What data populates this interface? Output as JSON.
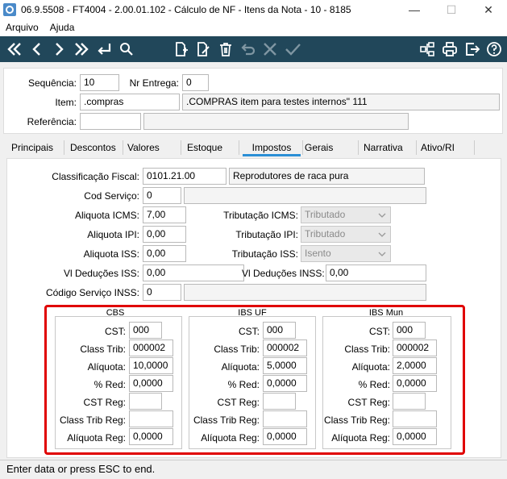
{
  "window": {
    "title": "06.9.5508 - FT4004 - 2.00.01.102 - Cálculo de NF - Itens da Nota - 10 - 8185",
    "minimize": "—",
    "maximize": "☐",
    "close": "✕"
  },
  "menu": {
    "arquivo": "Arquivo",
    "ajuda": "Ajuda"
  },
  "toolbar_icons": [
    "first-icon",
    "prev-icon",
    "next-icon",
    "last-icon",
    "return-icon",
    "search-icon",
    "new-icon",
    "edit-icon",
    "delete-icon",
    "undo-icon",
    "cancel-icon",
    "confirm-icon",
    "tree-icon",
    "print-icon",
    "exit-icon",
    "help-icon"
  ],
  "header": {
    "sequencia_label": "Sequência:",
    "sequencia": "10",
    "nr_entrega_label": "Nr Entrega:",
    "nr_entrega": "0",
    "item_label": "Item:",
    "item_code": ".compras",
    "item_desc": ".COMPRAS item para testes internos\" 111",
    "referencia_label": "Referência:",
    "referencia": "",
    "referencia_desc": ""
  },
  "tabs": [
    "Principais",
    "Descontos",
    "Valores",
    "Estoque",
    "Impostos",
    "Gerais",
    "Narrativa",
    "Ativo/RI"
  ],
  "active_tab": "Impostos",
  "impostos": {
    "class_fiscal_label": "Classificação Fiscal:",
    "class_fiscal": "0101.21.00",
    "class_fiscal_desc": "Reprodutores de raca pura",
    "cod_servico_label": "Cod Serviço:",
    "cod_servico": "0",
    "cod_servico_desc": "",
    "aliq_icms_label": "Aliquota ICMS:",
    "aliq_icms": "7,00",
    "trib_icms_label": "Tributação ICMS:",
    "trib_icms": "Tributado",
    "aliq_ipi_label": "Aliquota IPI:",
    "aliq_ipi": "0,00",
    "trib_ipi_label": "Tributação IPI:",
    "trib_ipi": "Tributado",
    "aliq_iss_label": "Aliquota ISS:",
    "aliq_iss": "0,00",
    "trib_iss_label": "Tributação ISS:",
    "trib_iss": "Isento",
    "ded_iss_label": "Vl Deduções ISS:",
    "ded_iss": "0,00",
    "ded_inss_label": "Vl Deduções INSS:",
    "ded_inss": "0,00",
    "cod_serv_inss_label": "Código Serviço INSS:",
    "cod_serv_inss": "0",
    "cod_serv_inss_desc": ""
  },
  "labels": {
    "cst": "CST:",
    "class_trib": "Class Trib:",
    "aliquota": "Alíquota:",
    "red": "% Red:",
    "cst_reg": "CST Reg:",
    "class_trib_reg": "Class Trib Reg:",
    "aliquota_reg": "Alíquota Reg:"
  },
  "groups": [
    {
      "title": "CBS",
      "cst": "000",
      "class_trib": "000002",
      "aliquota": "10,0000",
      "red": "0,0000",
      "cst_reg": "",
      "class_trib_reg": "",
      "aliquota_reg": "0,0000"
    },
    {
      "title": "IBS UF",
      "cst": "000",
      "class_trib": "000002",
      "aliquota": "5,0000",
      "red": "0,0000",
      "cst_reg": "",
      "class_trib_reg": "",
      "aliquota_reg": "0,0000"
    },
    {
      "title": "IBS Mun",
      "cst": "000",
      "class_trib": "000002",
      "aliquota": "2,0000",
      "red": "0,0000",
      "cst_reg": "",
      "class_trib_reg": "",
      "aliquota_reg": "0,0000"
    }
  ],
  "status": "Enter data or press ESC to end.",
  "colors": {
    "toolbar": "#21475a",
    "highlight": "#e00000",
    "tab_underline": "#2b8fd6"
  }
}
